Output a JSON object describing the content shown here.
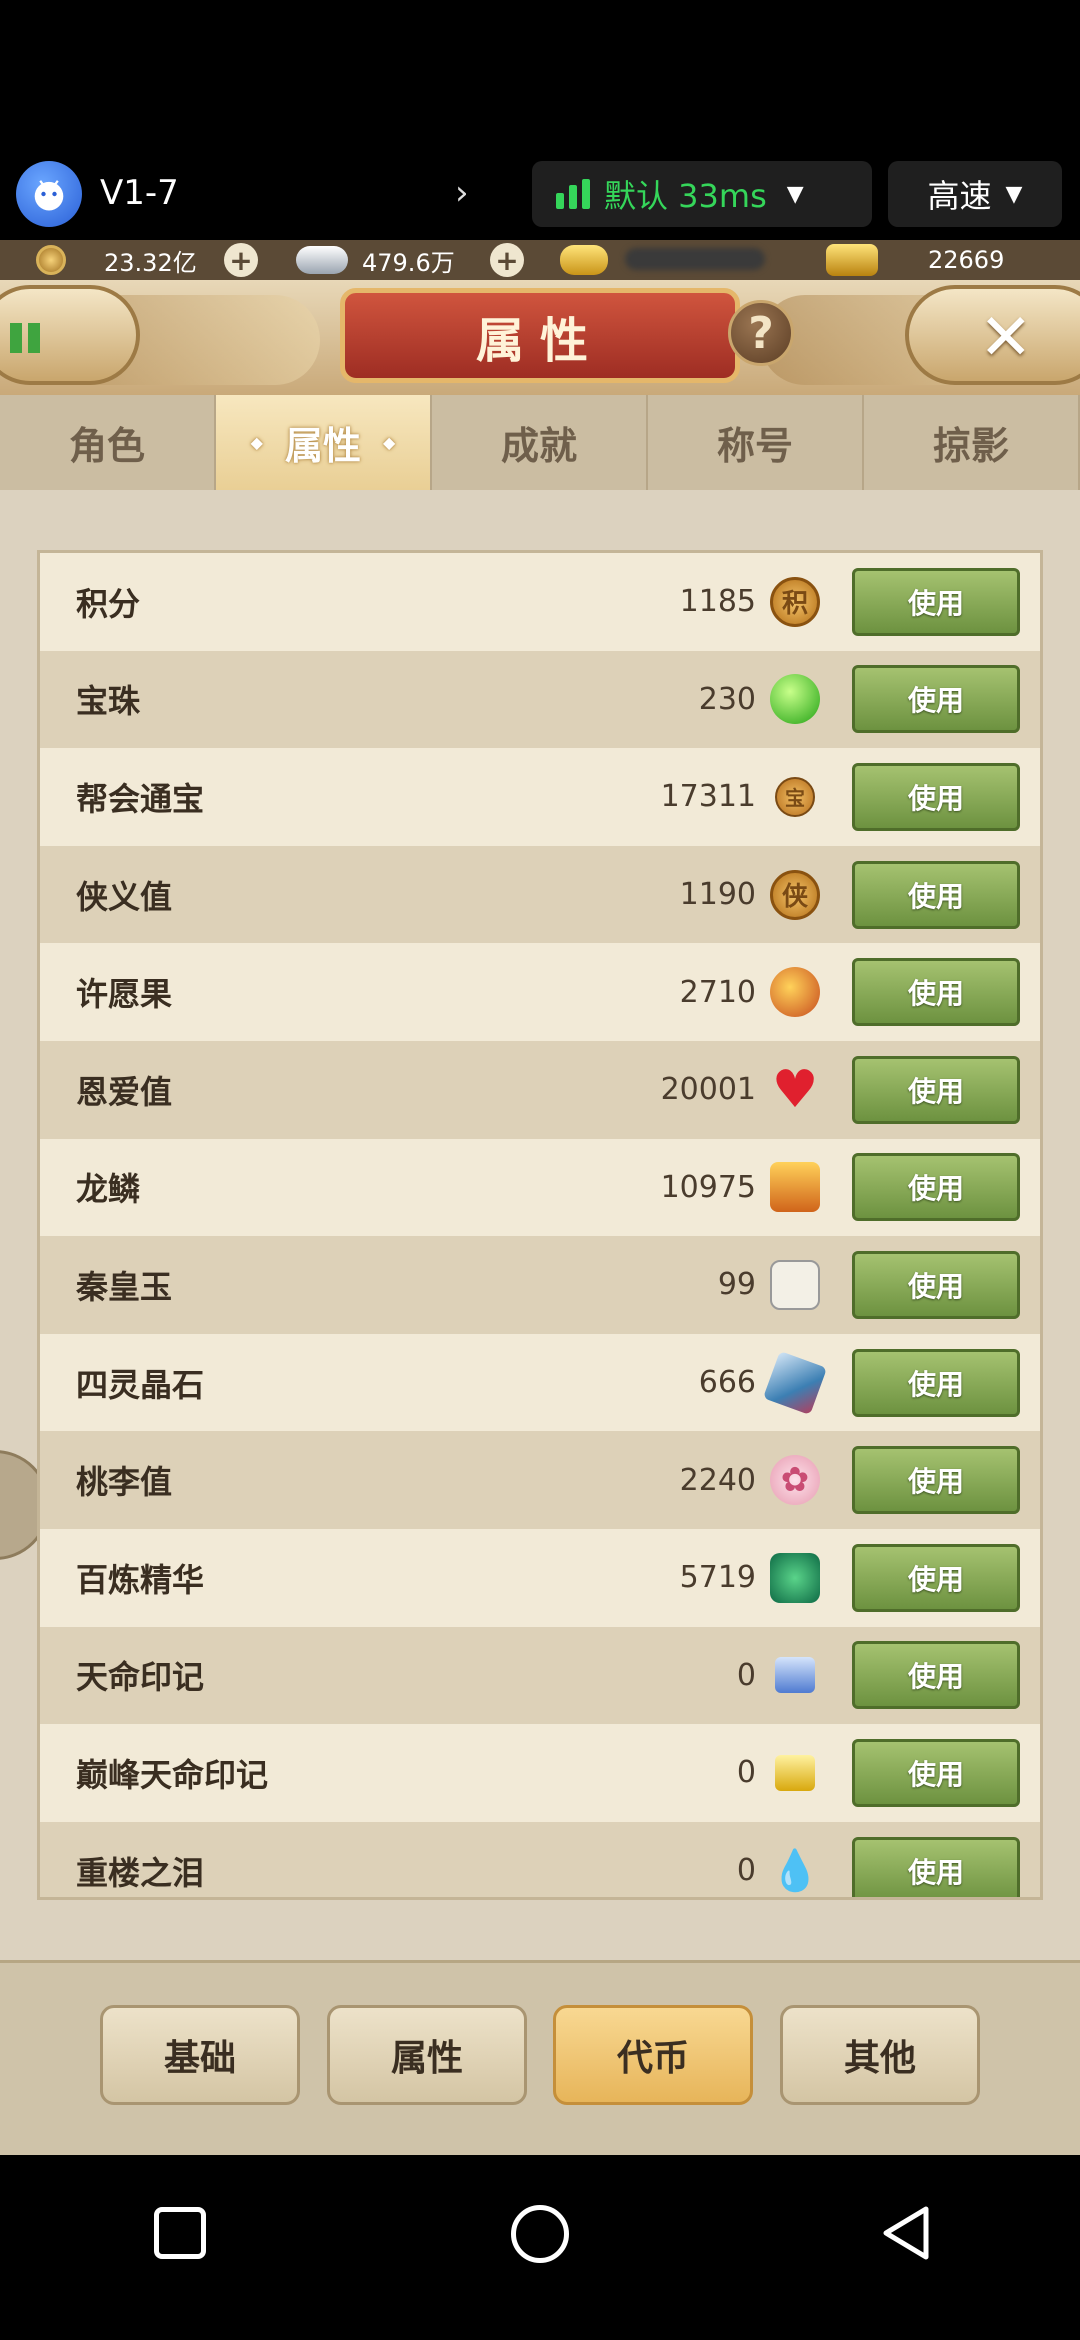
{
  "system_bar": {
    "vm_name": "V1-7",
    "network_label": "默认 33ms",
    "speed_label": "高速",
    "accent_green": "#35d65a"
  },
  "currency": {
    "gold_amount": "23.32亿",
    "silver_amount": "479.6万",
    "ingot_amount": "22669"
  },
  "header": {
    "title": "属性"
  },
  "tabs": [
    {
      "label": "角色",
      "active": false
    },
    {
      "label": "属性",
      "active": true
    },
    {
      "label": "成就",
      "active": false
    },
    {
      "label": "称号",
      "active": false
    },
    {
      "label": "掠影",
      "active": false
    }
  ],
  "items": [
    {
      "name": "积分",
      "value": "1185",
      "icon": "points-token-icon",
      "button": "使用"
    },
    {
      "name": "宝珠",
      "value": "230",
      "icon": "green-orb-icon",
      "button": "使用"
    },
    {
      "name": "帮会通宝",
      "value": "17311",
      "icon": "guild-coin-icon",
      "button": "使用"
    },
    {
      "name": "侠义值",
      "value": "1190",
      "icon": "chivalry-token-icon",
      "button": "使用"
    },
    {
      "name": "许愿果",
      "value": "2710",
      "icon": "wish-fruit-icon",
      "button": "使用"
    },
    {
      "name": "恩爱值",
      "value": "20001",
      "icon": "heart-icon",
      "button": "使用"
    },
    {
      "name": "龙鳞",
      "value": "10975",
      "icon": "dragon-scale-icon",
      "button": "使用"
    },
    {
      "name": "秦皇玉",
      "value": "99",
      "icon": "jade-icon",
      "button": "使用"
    },
    {
      "name": "四灵晶石",
      "value": "666",
      "icon": "crystal-icon",
      "button": "使用"
    },
    {
      "name": "桃李值",
      "value": "2240",
      "icon": "blossom-icon",
      "button": "使用"
    },
    {
      "name": "百炼精华",
      "value": "5719",
      "icon": "essence-gem-icon",
      "button": "使用"
    },
    {
      "name": "天命印记",
      "value": "0",
      "icon": "blue-seal-icon",
      "button": "使用"
    },
    {
      "name": "巅峰天命印记",
      "value": "0",
      "icon": "gold-seal-icon",
      "button": "使用"
    },
    {
      "name": "重楼之泪",
      "value": "0",
      "icon": "water-drop-icon",
      "button": "使用"
    }
  ],
  "footer_tabs": [
    {
      "label": "基础",
      "active": false
    },
    {
      "label": "属性",
      "active": false
    },
    {
      "label": "代币",
      "active": true
    },
    {
      "label": "其他",
      "active": false
    }
  ],
  "colors": {
    "use_button": "#7fa34d",
    "active_footer": "#eec574",
    "title_plate": "#b83a2c"
  }
}
